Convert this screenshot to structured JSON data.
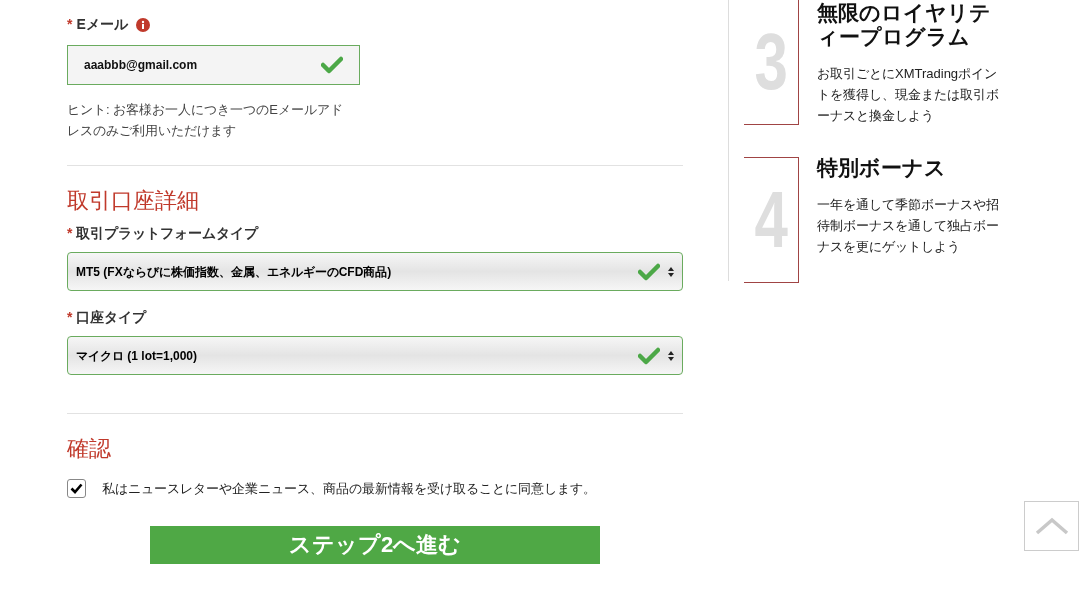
{
  "email": {
    "label": "Eメール",
    "required_mark": "*",
    "value": "aaabbb@gmail.com",
    "valid": true,
    "hint": "ヒント: お客様お一人につき一つのEメールアドレスのみご利用いただけます"
  },
  "account_section": {
    "title": "取引口座詳細",
    "fields": [
      {
        "label": "取引プラットフォームタイプ",
        "required_mark": "*",
        "value": "MT5 (FXならびに株価指数、金属、エネルギーのCFD商品)",
        "valid": true
      },
      {
        "label": "口座タイプ",
        "required_mark": "*",
        "value": "マイクロ (1 lot=1,000)",
        "valid": true
      }
    ]
  },
  "confirm_section": {
    "title": "確認",
    "checked": true,
    "consent": "私はニュースレターや企業ニュース、商品の最新情報を受け取ることに同意します。"
  },
  "submit_button": "ステップ2へ進む",
  "features": [
    {
      "number": "3",
      "title": "無限のロイヤリティープログラム",
      "text": "お取引ごとにXMTradingポイントを獲得し、現金または取引ボーナスと換金しよう"
    },
    {
      "number": "4",
      "title": "特別ボーナス",
      "text": "一年を通して季節ボーナスや招待制ボーナスを通して独占ボーナスを更にゲットしよう"
    }
  ]
}
